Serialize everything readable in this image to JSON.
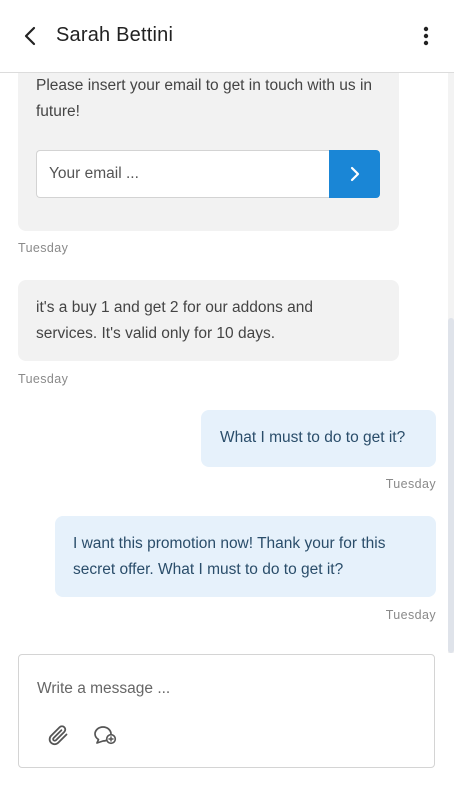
{
  "header": {
    "contact_name": "Sarah Bettini"
  },
  "messages": [
    {
      "direction": "incoming",
      "type": "email-form",
      "text": "Please insert your email to get in touch with us in future!",
      "input_placeholder": "Your email ...",
      "timestamp": "Tuesday"
    },
    {
      "direction": "incoming",
      "text": "it's a buy 1 and get 2 for our addons and services. It's valid only for 10 days.",
      "timestamp": "Tuesday"
    },
    {
      "direction": "outgoing",
      "text": "What I must to do to get it?",
      "timestamp": "Tuesday"
    },
    {
      "direction": "outgoing",
      "text": "I want this promotion now! Thank your for this secret offer. What I must to do to get it?",
      "timestamp": "Tuesday"
    }
  ],
  "composer": {
    "placeholder": "Write a message ..."
  },
  "icons": {
    "back": "chevron-left-icon",
    "more": "more-vertical-icon",
    "submit": "chevron-right-icon",
    "attach": "paperclip-icon",
    "emoji": "chat-bubble-icon"
  },
  "colors": {
    "accent": "#1a86d6",
    "incoming_bubble": "#f2f2f2",
    "outgoing_bubble": "#e6f1fb"
  }
}
